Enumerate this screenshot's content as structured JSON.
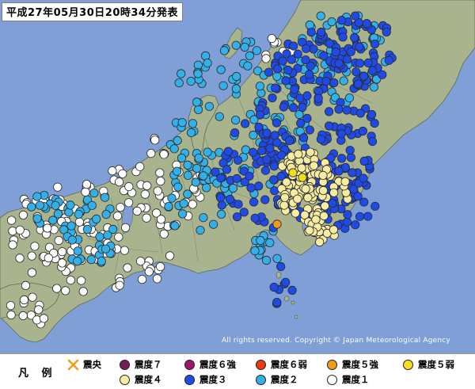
{
  "header": {
    "title": "平成27年05月30日20時34分発表"
  },
  "map": {
    "copyright": "All rights reserved. Copyright © Japan Meteorological Agency",
    "colors": {
      "sea": "#7f9fd6",
      "land": "#a9b48e",
      "border": "#7c8772",
      "coast": "#5f6a58"
    }
  },
  "legend": {
    "title": "凡 例",
    "items": [
      {
        "label": "震央",
        "shape": "cross",
        "color": "#f0a018"
      },
      {
        "label": "震度７",
        "shape": "circle",
        "color": "#7a1a58"
      },
      {
        "label": "震度６強",
        "shape": "circle",
        "color": "#a01468"
      },
      {
        "label": "震度６弱",
        "shape": "circle",
        "color": "#ee3a0f"
      },
      {
        "label": "震度５強",
        "shape": "circle",
        "color": "#f39a1e"
      },
      {
        "label": "震度５弱",
        "shape": "circle",
        "color": "#f4e01a"
      },
      {
        "label": "震度４",
        "shape": "circle",
        "color": "#f7eca2"
      },
      {
        "label": "震度３",
        "shape": "circle",
        "color": "#1f4ae6"
      },
      {
        "label": "震度２",
        "shape": "circle",
        "color": "#33b0e8"
      },
      {
        "label": "震度１",
        "shape": "circle",
        "color": "#ffffff"
      }
    ]
  }
}
